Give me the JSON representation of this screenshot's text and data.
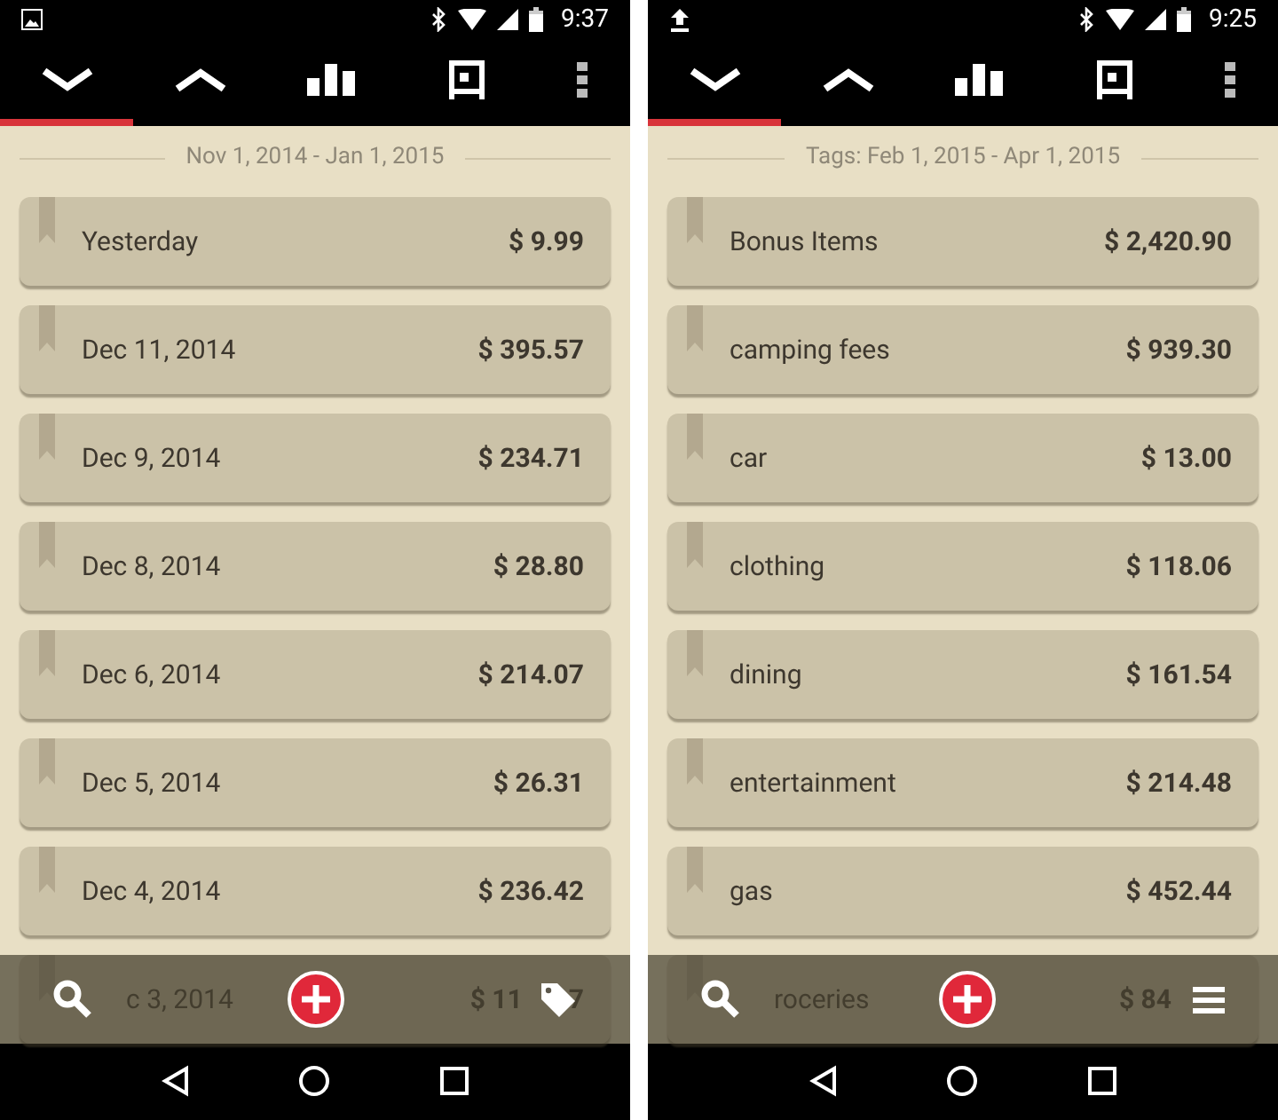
{
  "screens": [
    {
      "status_bar": {
        "time": "9:37"
      },
      "toolbar": [
        {
          "selected": true
        },
        {
          "selected": false
        },
        {
          "selected": false
        },
        {
          "selected": false
        },
        {
          "selected": false
        }
      ],
      "heading": "Nov 1, 2014 - Jan 1, 2015",
      "rows": [
        {
          "label": "Yesterday",
          "amount": "$ 9.99"
        },
        {
          "label": "Dec 11, 2014",
          "amount": "$ 395.57"
        },
        {
          "label": "Dec 9, 2014",
          "amount": "$ 234.71"
        },
        {
          "label": "Dec 8, 2014",
          "amount": "$ 28.80"
        },
        {
          "label": "Dec 6, 2014",
          "amount": "$ 214.07"
        },
        {
          "label": "Dec 5, 2014",
          "amount": "$ 26.31"
        },
        {
          "label": "Dec 4, 2014",
          "amount": "$ 236.42"
        },
        {
          "label": "c 3, 2014",
          "amount": "$ 11",
          "amount_end": "7"
        }
      ]
    },
    {
      "status_bar": {
        "time": "9:25"
      },
      "toolbar": [
        {
          "selected": true
        },
        {
          "selected": false
        },
        {
          "selected": false
        },
        {
          "selected": false
        },
        {
          "selected": false
        }
      ],
      "heading": "Tags: Feb 1, 2015 - Apr 1, 2015",
      "rows": [
        {
          "label": "Bonus Items",
          "amount": "$ 2,420.90"
        },
        {
          "label": "camping fees",
          "amount": "$ 939.30"
        },
        {
          "label": "car",
          "amount": "$ 13.00"
        },
        {
          "label": "clothing",
          "amount": "$ 118.06"
        },
        {
          "label": "dining",
          "amount": "$ 161.54"
        },
        {
          "label": "entertainment",
          "amount": "$ 214.48"
        },
        {
          "label": "gas",
          "amount": "$ 452.44"
        },
        {
          "label": "roceries",
          "amount": "$ 84"
        }
      ]
    }
  ]
}
